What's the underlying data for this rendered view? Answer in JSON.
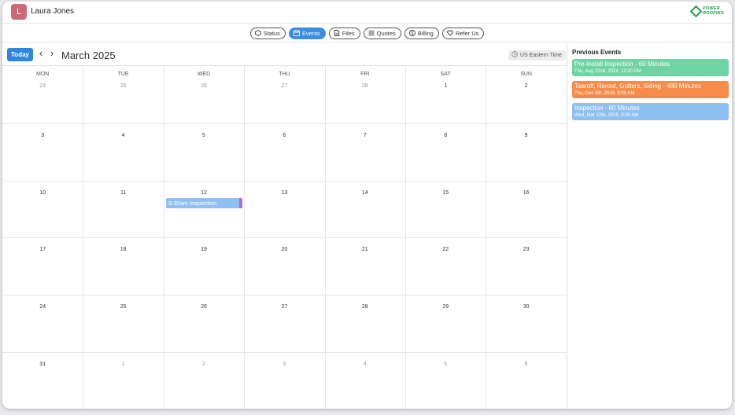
{
  "header": {
    "avatar_letter": "L",
    "user_name": "Laura Jones",
    "logo_line1": "POWER",
    "logo_line2": "ROOFING"
  },
  "tabs": [
    {
      "label": "Status",
      "icon": "status-icon"
    },
    {
      "label": "Events",
      "icon": "calendar-icon",
      "active": true
    },
    {
      "label": "Files",
      "icon": "file-icon"
    },
    {
      "label": "Quotes",
      "icon": "list-icon"
    },
    {
      "label": "Billing",
      "icon": "dollar-icon"
    },
    {
      "label": "Refer Us",
      "icon": "heart-icon"
    }
  ],
  "calendar": {
    "today_label": "Today",
    "month_title": "March 2025",
    "timezone_label": "US Eastern Time",
    "weekdays": [
      "MON",
      "TUE",
      "WED",
      "THU",
      "FRI",
      "SAT",
      "SUN"
    ],
    "weeks": [
      [
        {
          "d": "24",
          "out": true
        },
        {
          "d": "25",
          "out": true
        },
        {
          "d": "26",
          "out": true
        },
        {
          "d": "27",
          "out": true
        },
        {
          "d": "28",
          "out": true
        },
        {
          "d": "1",
          "out": false
        },
        {
          "d": "2",
          "out": false
        }
      ],
      [
        {
          "d": "3"
        },
        {
          "d": "4"
        },
        {
          "d": "5"
        },
        {
          "d": "6"
        },
        {
          "d": "7"
        },
        {
          "d": "8"
        },
        {
          "d": "9"
        }
      ],
      [
        {
          "d": "10"
        },
        {
          "d": "11"
        },
        {
          "d": "12"
        },
        {
          "d": "13"
        },
        {
          "d": "14"
        },
        {
          "d": "15"
        },
        {
          "d": "16"
        }
      ],
      [
        {
          "d": "17"
        },
        {
          "d": "18"
        },
        {
          "d": "19"
        },
        {
          "d": "20"
        },
        {
          "d": "21"
        },
        {
          "d": "22"
        },
        {
          "d": "23"
        }
      ],
      [
        {
          "d": "24"
        },
        {
          "d": "25"
        },
        {
          "d": "26"
        },
        {
          "d": "27"
        },
        {
          "d": "28"
        },
        {
          "d": "29"
        },
        {
          "d": "30"
        }
      ],
      [
        {
          "d": "31"
        },
        {
          "d": "1",
          "out": true
        },
        {
          "d": "2",
          "out": true
        },
        {
          "d": "3",
          "out": true
        },
        {
          "d": "4",
          "out": true
        },
        {
          "d": "5",
          "out": true
        },
        {
          "d": "6",
          "out": true
        }
      ]
    ],
    "event_chip_label": "9:30am Inspection"
  },
  "previous_events": {
    "title": "Previous Events",
    "items": [
      {
        "title": "Pre-Install Inspection - 60 Minutes",
        "date": "Thu, Aug 22nd, 2024, 12:00 PM",
        "color": "#6fd4a3"
      },
      {
        "title": "Tearoff, Reroof, Gutters, Siding  - 480 Minutes",
        "date": "Thu, Dec 5th, 2024, 9:00 AM",
        "color": "#f78c4a"
      },
      {
        "title": "Inspection - 60 Minutes",
        "date": "Wed, Mar 12th, 2025, 9:30 AM",
        "color": "#8ec0f3"
      }
    ]
  },
  "colors": {
    "accent": "#2f87dc",
    "avatar": "#c96a78",
    "brand_green": "#1f9c4a"
  }
}
